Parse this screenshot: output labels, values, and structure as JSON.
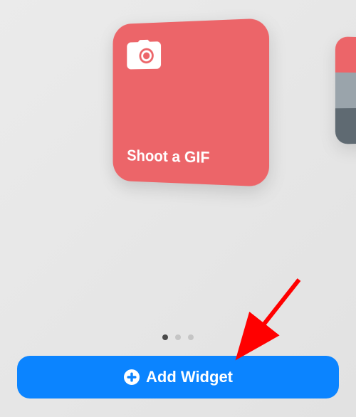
{
  "widget": {
    "title": "Shoot a GIF",
    "icon_name": "camera-icon",
    "color": "#ec6569"
  },
  "pager": {
    "total": 3,
    "active": 0
  },
  "button": {
    "label": "Add Widget",
    "icon_name": "plus-circle-icon"
  }
}
